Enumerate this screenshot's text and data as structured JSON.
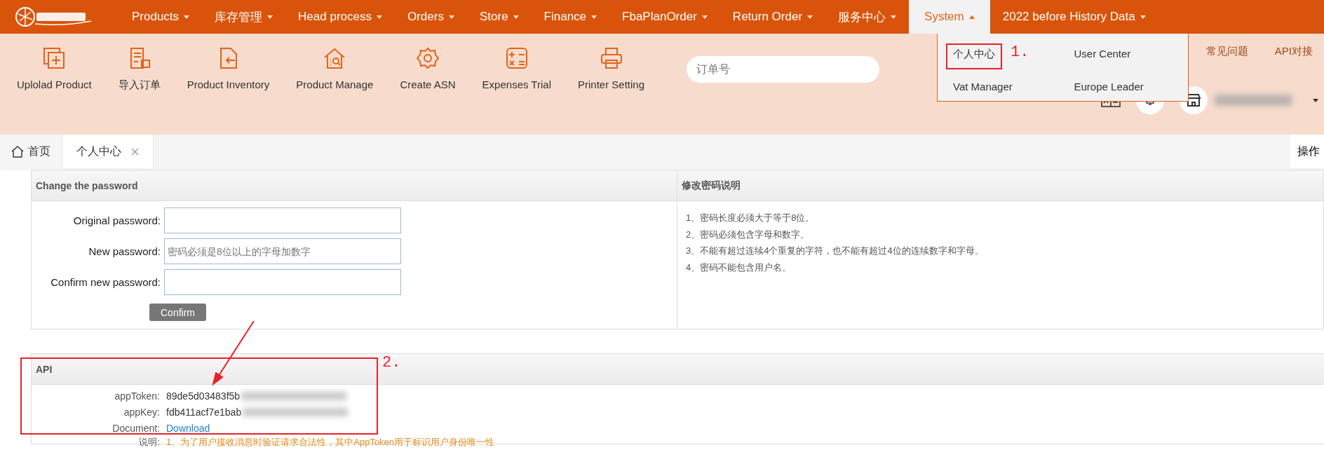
{
  "nav": {
    "items": [
      {
        "label": "Products",
        "selected": false
      },
      {
        "label": "库存管理",
        "selected": false
      },
      {
        "label": "Head process",
        "selected": false
      },
      {
        "label": "Orders",
        "selected": false
      },
      {
        "label": "Store",
        "selected": false
      },
      {
        "label": "Finance",
        "selected": false
      },
      {
        "label": "FbaPlanOrder",
        "selected": false
      },
      {
        "label": "Return Order",
        "selected": false
      },
      {
        "label": "服务中心",
        "selected": false
      },
      {
        "label": "System",
        "selected": true
      },
      {
        "label": "2022 before History Data",
        "selected": false
      }
    ]
  },
  "toolbar": {
    "items": [
      "Uplolad Product",
      "导入订单",
      "Product Inventory",
      "Product Manage",
      "Create ASN",
      "Expenses Trial",
      "Printer Setting"
    ]
  },
  "search": {
    "placeholder": "订单号"
  },
  "system_menu": {
    "annotation": "1.",
    "items": [
      {
        "label": "个人中心",
        "annotated": true
      },
      {
        "label": "User Center",
        "annotated": false
      },
      {
        "label": "Vat Manager",
        "annotated": false
      },
      {
        "label": "Europe Leader",
        "annotated": false
      }
    ]
  },
  "links": [
    "常见问题",
    "API对接"
  ],
  "tabs": [
    {
      "label": "首页",
      "selected": false,
      "kind": "home"
    },
    {
      "label": "个人中心",
      "selected": true,
      "kind": "closable"
    }
  ],
  "tab_actions": "操作",
  "password_panel": {
    "title": "Change the password",
    "button": "Confirm",
    "fields": [
      {
        "label": "Original password:"
      },
      {
        "label": "New password:",
        "placeholder": "密码必须是8位以上的字母加数字"
      },
      {
        "label": "Confirm new password:"
      }
    ]
  },
  "rules_panel": {
    "title": "修改密码说明",
    "items": [
      "1、密码长度必须大于等于8位。",
      "2、密码必须包含字母和数字。",
      "3、不能有超过连续4个重复的字符，也不能有超过4位的连续数字和字母。",
      "4、密码不能包含用户名。"
    ]
  },
  "api_panel": {
    "title": "API",
    "annotation": "2.",
    "rows": [
      {
        "label": "appToken:",
        "value": "89de5d03483f5b",
        "kind": "masked"
      },
      {
        "label": "appKey:",
        "value": "fdb411acf7e1bab",
        "kind": "masked"
      },
      {
        "label": "Document:",
        "value": "Download",
        "kind": "link"
      }
    ],
    "note": {
      "label": "说明:",
      "text": "1、为了用户接收消息时验证请求合法性，其中AppToken用于标识用户身份唯一性"
    }
  }
}
